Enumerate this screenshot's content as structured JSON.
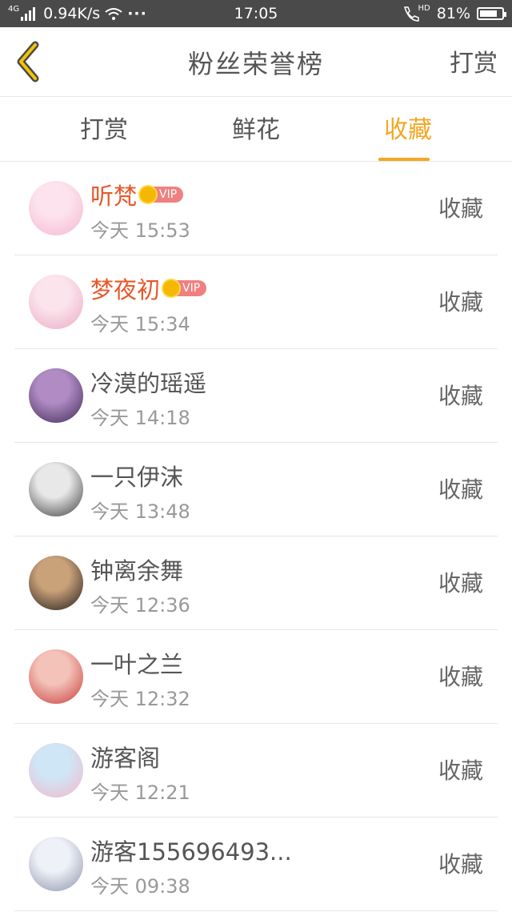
{
  "status_bar": {
    "network": "4G",
    "speed": "0.94K/s",
    "dots": "···",
    "time": "17:05",
    "hd_label": "HD",
    "battery": "81%",
    "battery_level": 0.81
  },
  "nav": {
    "title": "粉丝荣誉榜",
    "right_label": "打赏"
  },
  "tabs": [
    {
      "label": "打赏",
      "active": false
    },
    {
      "label": "鲜花",
      "active": false
    },
    {
      "label": "收藏",
      "active": true
    }
  ],
  "vip_label": "VIP",
  "rows": [
    {
      "name": "听梵",
      "vip": true,
      "time": "今天 15:53",
      "action": "收藏",
      "avatar_colors": [
        "#fde3ee",
        "#f4b6cf"
      ]
    },
    {
      "name": "梦夜初",
      "vip": true,
      "time": "今天 15:34",
      "action": "收藏",
      "avatar_colors": [
        "#fbe4ec",
        "#eaa9c4"
      ]
    },
    {
      "name": "冷漠的瑶遥",
      "vip": false,
      "time": "今天 14:18",
      "action": "收藏",
      "avatar_colors": [
        "#b08bc4",
        "#3f2a55"
      ]
    },
    {
      "name": "一只伊沫",
      "vip": false,
      "time": "今天 13:48",
      "action": "收藏",
      "avatar_colors": [
        "#e8e8e8",
        "#3a3a3a"
      ]
    },
    {
      "name": "钟离余舞",
      "vip": false,
      "time": "今天 12:36",
      "action": "收藏",
      "avatar_colors": [
        "#caa27a",
        "#1e1a18"
      ]
    },
    {
      "name": "一叶之兰",
      "vip": false,
      "time": "今天 12:32",
      "action": "收藏",
      "avatar_colors": [
        "#f3c2b8",
        "#c93a3a"
      ]
    },
    {
      "name": "游客阁",
      "vip": false,
      "time": "今天 12:21",
      "action": "收藏",
      "avatar_colors": [
        "#cfe6f6",
        "#f3b7c9"
      ]
    },
    {
      "name": "游客155696493...",
      "vip": false,
      "time": "今天 09:38",
      "action": "收藏",
      "avatar_colors": [
        "#eef1f7",
        "#8a92a8"
      ]
    }
  ],
  "colors": {
    "accent": "#f5a623",
    "vip_name": "#e8572a",
    "status_bar_bg": "#4a4a4a"
  }
}
